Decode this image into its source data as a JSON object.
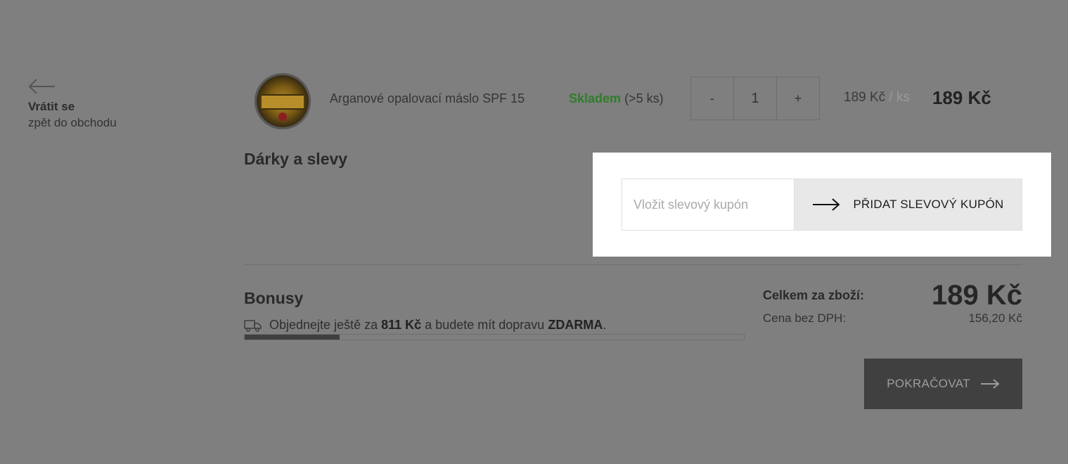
{
  "back": {
    "title": "Vrátit se",
    "subtitle": "zpět do obchodu"
  },
  "cart_item": {
    "name": "Arganové opalovací máslo SPF 15",
    "stock_status": "Skladem",
    "stock_detail": "(>5 ks)",
    "quantity": "1",
    "minus_label": "-",
    "plus_label": "+",
    "unit_price": "189 Kč",
    "unit_sep": "/",
    "unit": "ks",
    "line_total": "189 Kč"
  },
  "gifts": {
    "title": "Dárky a slevy",
    "coupon_placeholder": "Vložit slevový kupón",
    "coupon_button_label": "PŘIDAT SLEVOVÝ KUPÓN"
  },
  "bonuses": {
    "title": "Bonusy",
    "msg_prefix": "Objednejte ještě za",
    "msg_amount": "811 Kč",
    "msg_middle": "a budete mít dopravu",
    "msg_free": "ZDARMA",
    "msg_suffix": ".",
    "progress_fraction": 0.19
  },
  "totals": {
    "label": "Celkem za zboží:",
    "value": "189 Kč",
    "net_label": "Cena bez DPH:",
    "net_value": "156,20 Kč"
  },
  "continue_button_label": "POKRAČOVAT",
  "colors": {
    "overlay_background": "#7f7f7f",
    "stock_green": "#2f7d2a",
    "continue_button_bg": "#404040",
    "coupon_panel_bg": "#ffffff"
  },
  "icons": {
    "back": "arrow-left-icon",
    "coupon": "arrow-right-icon",
    "shipping": "truck-icon",
    "continue": "arrow-right-icon"
  }
}
